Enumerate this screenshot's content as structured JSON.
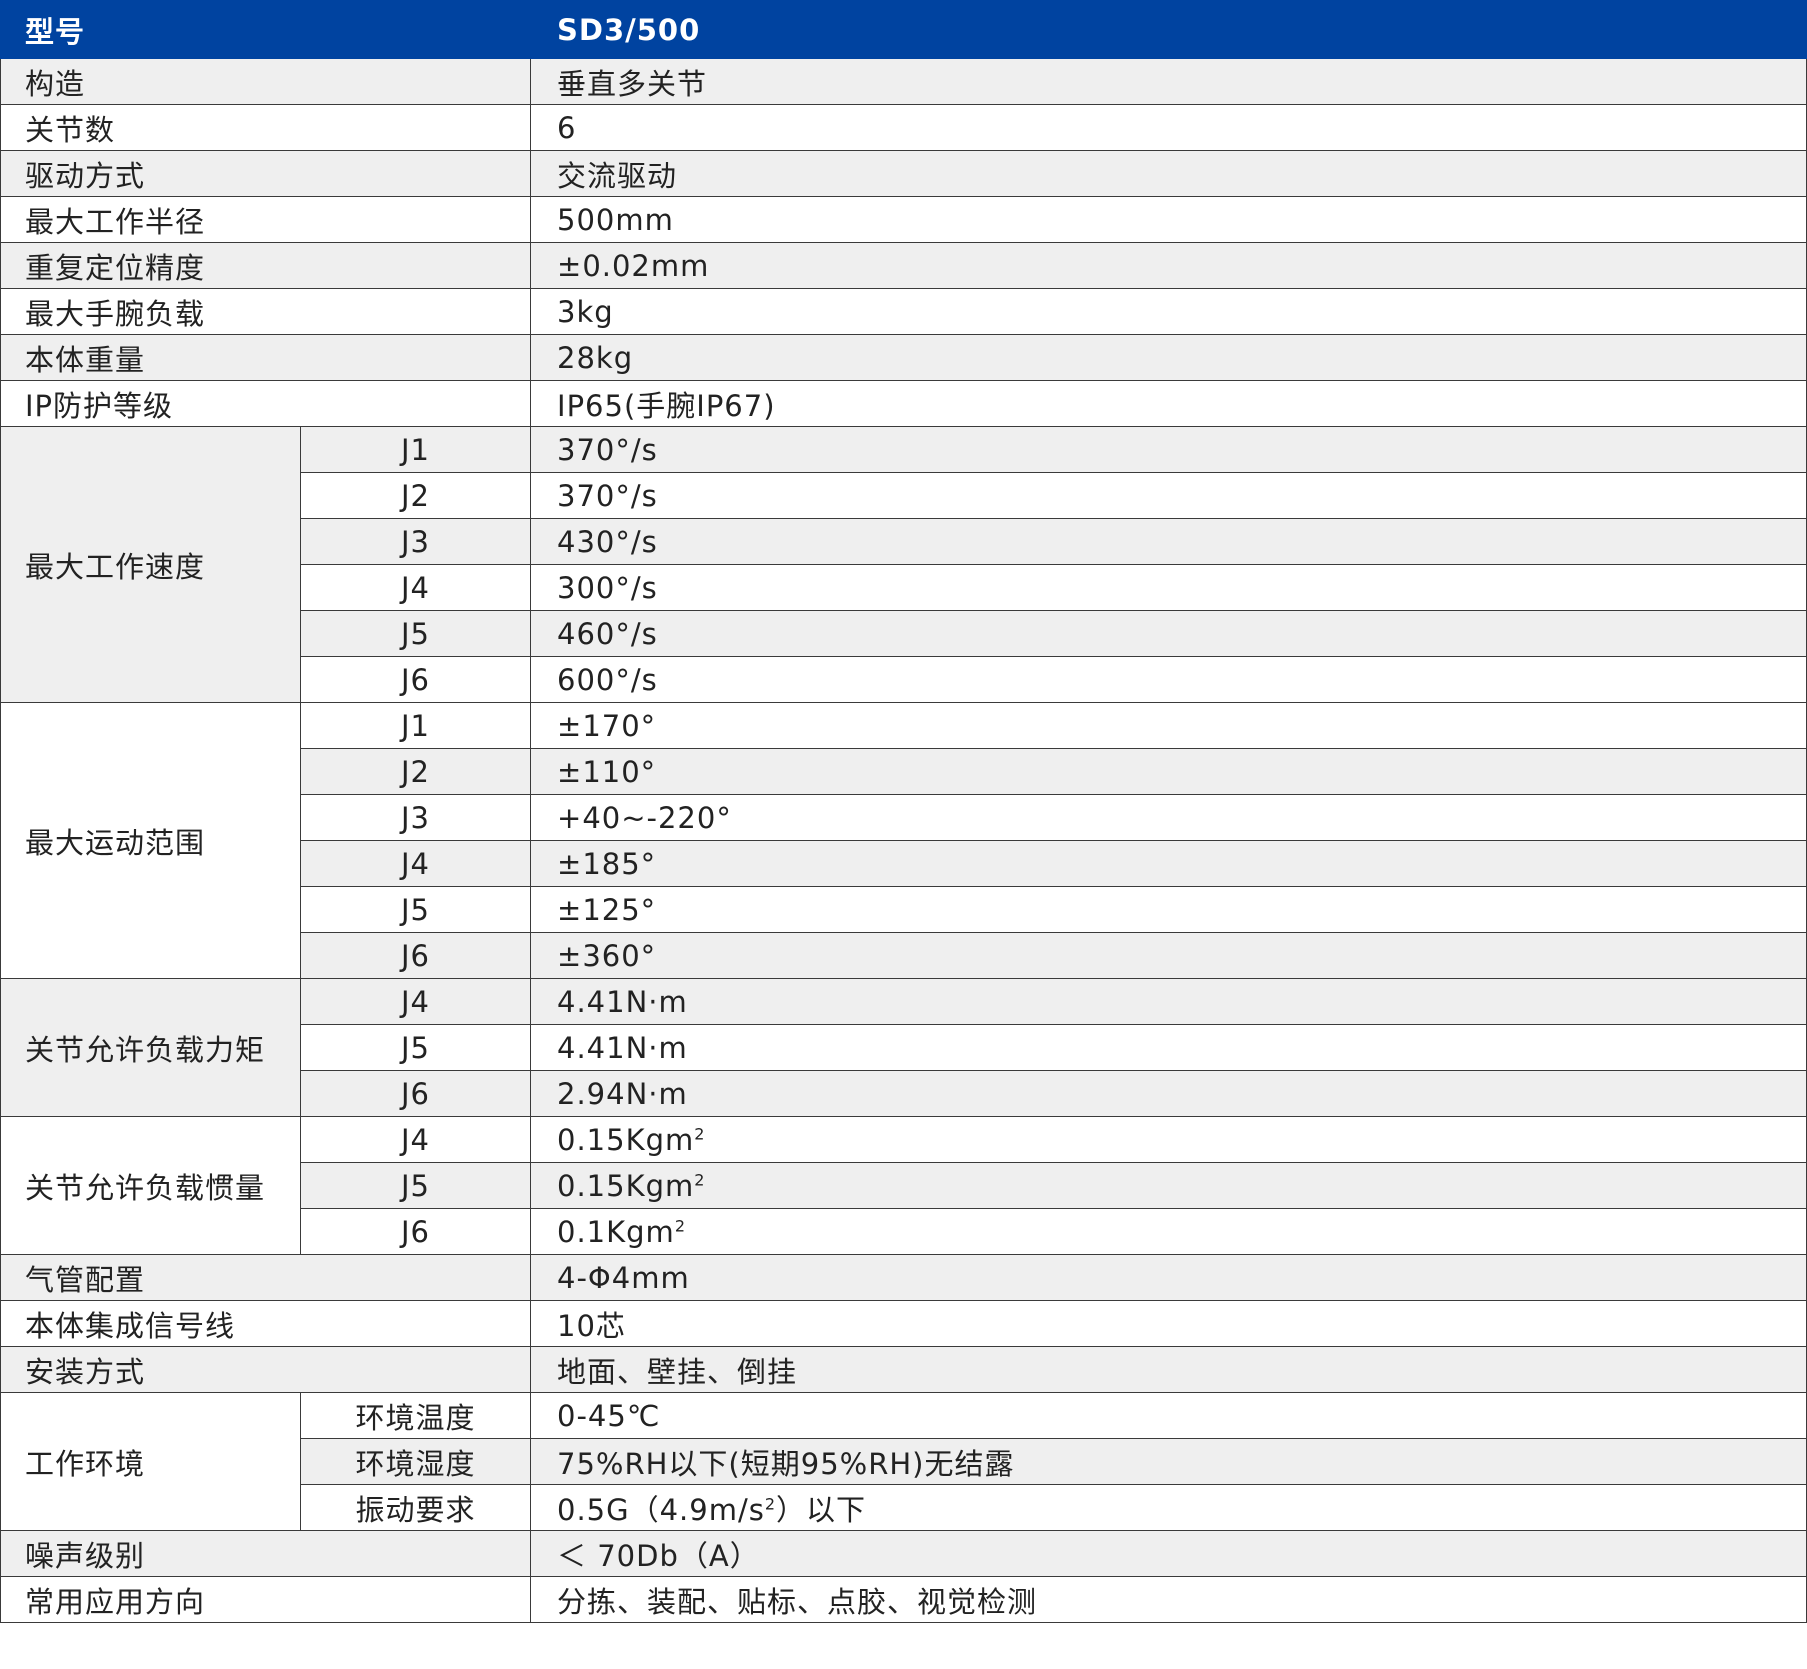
{
  "header": {
    "label": "型号",
    "value": "SD3/500"
  },
  "specs": {
    "structure": {
      "label": "构造",
      "value": "垂直多关节"
    },
    "joints": {
      "label": "关节数",
      "value": "6"
    },
    "drive": {
      "label": "驱动方式",
      "value": "交流驱动"
    },
    "reach": {
      "label": "最大工作半径",
      "value": "500mm"
    },
    "repeatability": {
      "label": "重复定位精度",
      "value": "±0.02mm"
    },
    "payload": {
      "label": "最大手腕负载",
      "value": "3kg"
    },
    "weight": {
      "label": "本体重量",
      "value": "28kg"
    },
    "ip": {
      "label": "IP防护等级",
      "value": "IP65(手腕IP67)"
    }
  },
  "speed": {
    "label": "最大工作速度",
    "rows": [
      {
        "axis": "J1",
        "value": "370°/s"
      },
      {
        "axis": "J2",
        "value": "370°/s"
      },
      {
        "axis": "J3",
        "value": "430°/s"
      },
      {
        "axis": "J4",
        "value": "300°/s"
      },
      {
        "axis": "J5",
        "value": "460°/s"
      },
      {
        "axis": "J6",
        "value": "600°/s"
      }
    ]
  },
  "range": {
    "label": "最大运动范围",
    "rows": [
      {
        "axis": "J1",
        "value": "±170°"
      },
      {
        "axis": "J2",
        "value": "±110°"
      },
      {
        "axis": "J3",
        "value": "+40~-220°"
      },
      {
        "axis": "J4",
        "value": "±185°"
      },
      {
        "axis": "J5",
        "value": "±125°"
      },
      {
        "axis": "J6",
        "value": "±360°"
      }
    ]
  },
  "torque": {
    "label": "关节允许负载力矩",
    "rows": [
      {
        "axis": "J4",
        "value": "4.41N·m"
      },
      {
        "axis": "J5",
        "value": "4.41N·m"
      },
      {
        "axis": "J6",
        "value": "2.94N·m"
      }
    ]
  },
  "inertia": {
    "label": "关节允许负载惯量",
    "sup": "2",
    "rows": [
      {
        "axis": "J4",
        "value": "0.15Kgm"
      },
      {
        "axis": "J5",
        "value": "0.15Kgm"
      },
      {
        "axis": "J6",
        "value": "0.1Kgm"
      }
    ]
  },
  "misc": {
    "air": {
      "label": "气管配置",
      "value": "4-Φ4mm"
    },
    "signal": {
      "label": "本体集成信号线",
      "value": "10芯"
    },
    "mount": {
      "label": "安装方式",
      "value": "地面、壁挂、倒挂"
    }
  },
  "environment": {
    "label": "工作环境",
    "temperature": {
      "label": "环境温度",
      "value": "0-45℃"
    },
    "humidity": {
      "label": "环境湿度",
      "value": "75%RH以下(短期95%RH)无结露"
    },
    "vibration": {
      "label": "振动要求",
      "value_pre": "0.5G（4.9m/s",
      "sup": "2",
      "value_post": "）以下"
    }
  },
  "noise": {
    "label": "噪声级别",
    "value": "＜ 70Db（A）"
  },
  "application": {
    "label": "常用应用方向",
    "value": "分拣、装配、贴标、点胶、视觉检测"
  }
}
